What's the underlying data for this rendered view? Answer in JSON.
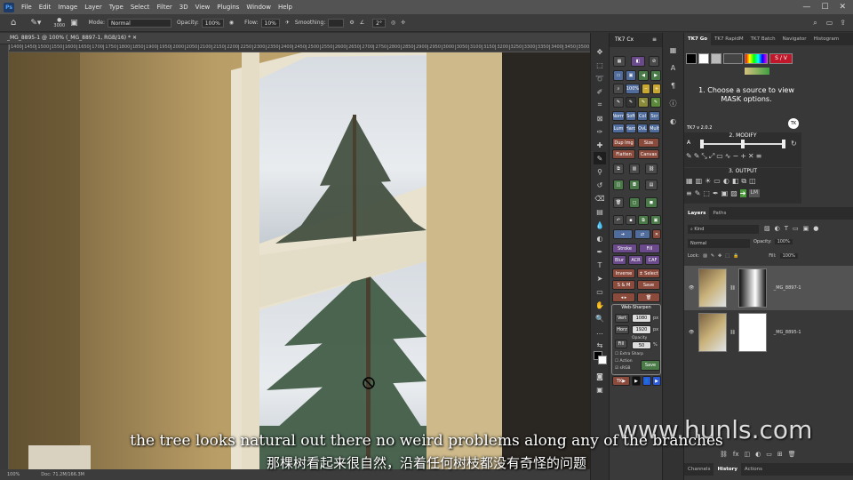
{
  "menu": {
    "logo": "Ps",
    "items": [
      "File",
      "Edit",
      "Image",
      "Layer",
      "Type",
      "Select",
      "Filter",
      "3D",
      "View",
      "Plugins",
      "Window",
      "Help"
    ]
  },
  "options": {
    "brush_size": "3000",
    "mode_label": "Mode:",
    "mode_value": "Normal",
    "opacity_label": "Opacity:",
    "opacity_value": "100%",
    "flow_label": "Flow:",
    "flow_value": "10%",
    "smoothing_label": "Smoothing:",
    "angle_value": "2°"
  },
  "document": {
    "tab": "_MG_8895-1 @ 100% (_MG_8897-1, RGB/16) *",
    "zoom": "100%",
    "doc_size": "Doc: 71.2M/166.3M"
  },
  "ruler": {
    "ticks": [
      "1400",
      "1450",
      "1500",
      "1550",
      "1600",
      "1650",
      "1700",
      "1750",
      "1800",
      "1850",
      "1900",
      "1950",
      "2000",
      "2050",
      "2100",
      "2150",
      "2200",
      "2250",
      "2300",
      "2350",
      "2400",
      "2450",
      "2500",
      "2550",
      "2600",
      "2650",
      "2700",
      "2750",
      "2800",
      "2850",
      "2900",
      "2950",
      "3000",
      "3050",
      "3100",
      "3150",
      "3200",
      "3250",
      "3300",
      "3350",
      "3400",
      "3450",
      "3500"
    ]
  },
  "tk7": {
    "title": "TK7 Cx",
    "row_norm": [
      "Norm",
      "Soft",
      "Col",
      "Scr"
    ],
    "row_lum": [
      "Lum",
      "Hard",
      "OvL",
      "Mult"
    ],
    "dup_img": "Dup Img",
    "size": "Size",
    "flatten": "Flatten",
    "canvas": "Canvas",
    "zoom_value": "100%",
    "stroke": "Stroke",
    "fill": "Fill",
    "blur": "Blur",
    "acr": "ACR",
    "caf": "CAF",
    "inverse": "Inverse",
    "select": "± Select",
    "sm": "S & M",
    "save": "Save",
    "websharpen": "Web-Sharpen",
    "vert": "Vert",
    "vert_val": "1080",
    "horz": "Horz",
    "horz_val": "1920",
    "px": "px",
    "opacity": "Opacity",
    "fill2": "Fill",
    "opacity_val": "50",
    "pct": "%",
    "extra_sharp": "Extra Sharp",
    "action": "Action",
    "srgb": "sRGB",
    "save2": "Save",
    "tk": "TK"
  },
  "right_tabs": [
    "TK7 Go",
    "TK7 RapidM",
    "TK7 Batch",
    "Navigator",
    "Histogram"
  ],
  "tk7go": {
    "sv": "S / V",
    "choose": "1. Choose a source to view MASK options.",
    "version": "TK7 v 2.0.2",
    "modify": "2. MODIFY",
    "output": "3. OUTPUT",
    "lm": "LM",
    "a_label": "A"
  },
  "layers_panel": {
    "tabs": [
      "Layers",
      "Paths"
    ],
    "kind": "Kind",
    "blend": "Normal",
    "opacity_label": "Opacity:",
    "opacity": "100%",
    "lock_label": "Lock:",
    "fill_label": "Fill:",
    "fill": "100%",
    "layers": [
      {
        "name": "_MG_8897-1"
      },
      {
        "name": "_MG_8895-1"
      }
    ]
  },
  "bottom_tabs": [
    "Channels",
    "History",
    "Actions"
  ],
  "watermark": "www.hunls.com",
  "subtitle_en": "the tree looks natural out there no weird problems along any of the branches",
  "subtitle_zh": "那棵树看起来很自然，沿着任何树枝都没有奇怪的问题",
  "colors": {
    "accent": "#4f6c9c",
    "sv_red": "#c0182a"
  }
}
